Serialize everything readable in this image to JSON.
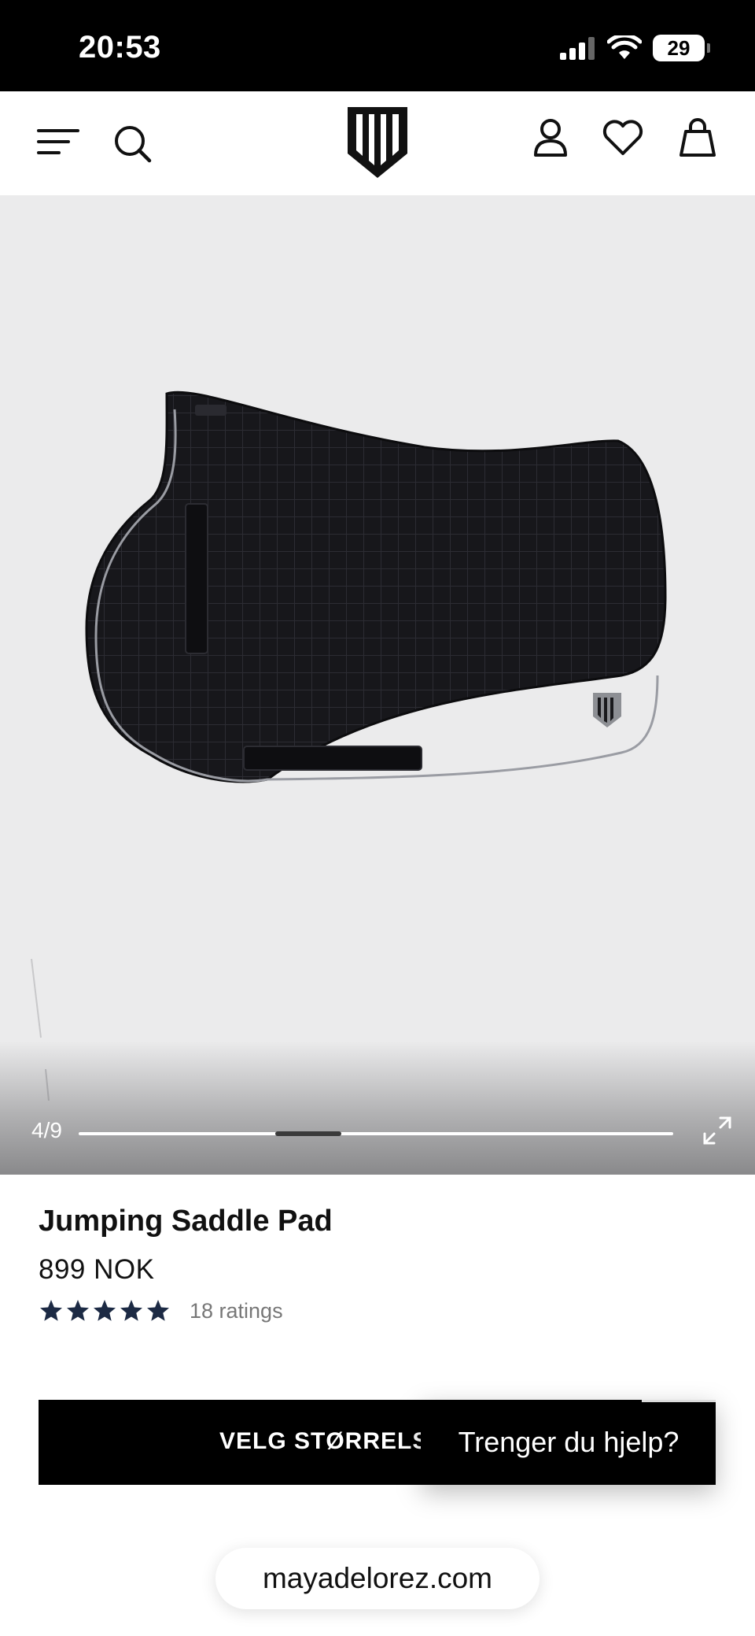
{
  "status_bar": {
    "time": "20:53",
    "battery": "29"
  },
  "header": {
    "menu_icon": "menu-icon",
    "search_icon": "search-icon",
    "logo_icon": "brand-shield-logo",
    "account_icon": "user-icon",
    "wishlist_icon": "heart-icon",
    "cart_icon": "bag-icon"
  },
  "gallery": {
    "counter": "4/9",
    "current_index": 4,
    "total": 9,
    "expand_icon": "expand-icon"
  },
  "product": {
    "title": "Jumping Saddle Pad",
    "price": "899 NOK",
    "rating_stars": 5,
    "rating_count": "18 ratings"
  },
  "cta": {
    "label": "VELG STØRRELSE"
  },
  "help_widget": {
    "label": "Trenger du hjelp?"
  },
  "browser": {
    "url": "mayadelorez.com"
  },
  "colors": {
    "star": "#1c2a44",
    "cta_bg": "#000000",
    "gallery_bg": "#ebebec"
  }
}
